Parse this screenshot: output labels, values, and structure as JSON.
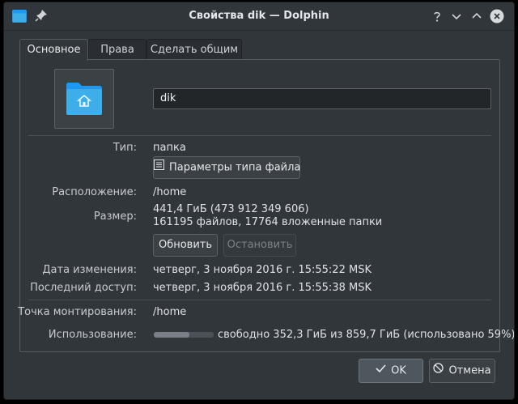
{
  "titlebar": {
    "title": "Свойства dik — Dolphin"
  },
  "tabs": [
    {
      "label": "Основное",
      "active": true
    },
    {
      "label": "Права",
      "active": false
    },
    {
      "label": "Сделать общим",
      "active": false
    }
  ],
  "general": {
    "name_value": "dik",
    "type_label": "Тип:",
    "type_value": "папка",
    "filetype_button": "Параметры типа файла",
    "location_label": "Расположение:",
    "location_value": "/home",
    "size_label": "Размер:",
    "size_value": "441,4 ГиБ (473 912 349 606)",
    "size_details": "161195 файлов, 17764 вложенные папки",
    "refresh_button": "Обновить",
    "stop_button": "Остановить",
    "modified_label": "Дата изменения:",
    "modified_value": "четверг, 3 ноября 2016 г. 15:55:22 MSK",
    "accessed_label": "Последний доступ:",
    "accessed_value": "четверг, 3 ноября 2016 г. 15:55:38 MSK",
    "mount_label": "Точка монтирования:",
    "mount_value": "/home",
    "usage_label": "Использование:",
    "usage_text": "свободно 352,3 ГиБ из 859,7 ГиБ (использовано 59%)",
    "usage_percent": 59
  },
  "footer": {
    "ok_label": "OK",
    "cancel_label": "Отмена"
  },
  "colors": {
    "window_bg": "#31363b",
    "folder_blue": "#3daee9",
    "text": "#dfe2e6"
  },
  "icons": [
    "app-window-icon",
    "pin-icon",
    "help-icon",
    "minimize-icon",
    "maximize-icon",
    "close-icon",
    "folder-home-icon",
    "file-type-icon",
    "checkmark-icon",
    "cancel-icon"
  ]
}
